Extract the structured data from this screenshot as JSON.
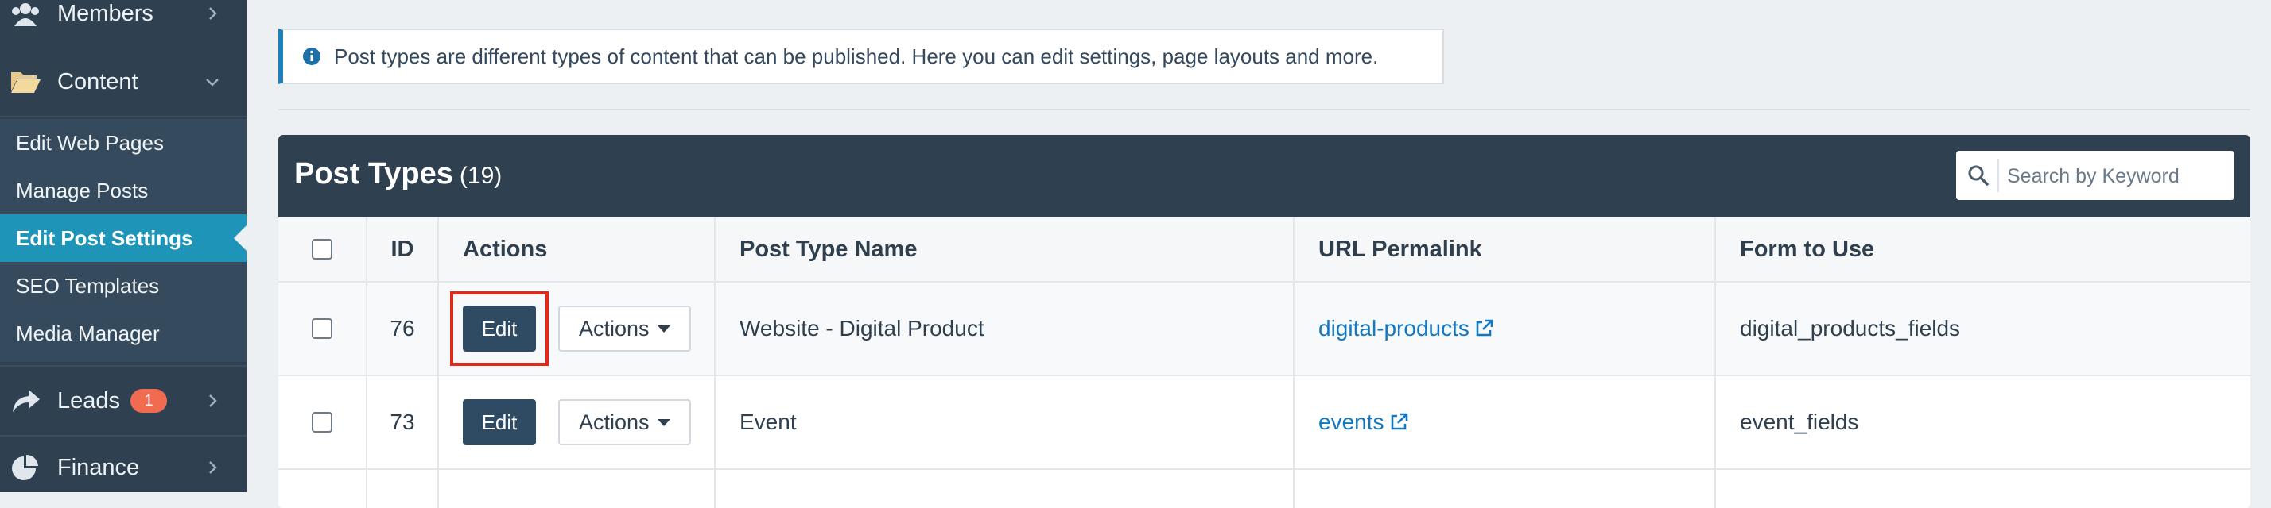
{
  "sidebar": {
    "members_label": "Members",
    "content_label": "Content",
    "submenu": [
      {
        "label": "Edit Web Pages"
      },
      {
        "label": "Manage Posts"
      },
      {
        "label": "Edit Post Settings"
      },
      {
        "label": "SEO Templates"
      },
      {
        "label": "Media Manager"
      }
    ],
    "leads_label": "Leads",
    "leads_badge": "1",
    "finance_label": "Finance"
  },
  "info": {
    "text": "Post types are different types of content that can be published. Here you can edit settings, page layouts and more."
  },
  "panel": {
    "title": "Post Types",
    "count": "(19)",
    "search_placeholder": "Search by Keyword"
  },
  "table": {
    "headers": {
      "id": "ID",
      "actions": "Actions",
      "name": "Post Type Name",
      "permalink": "URL Permalink",
      "form": "Form to Use"
    },
    "edit_label": "Edit",
    "actions_label": "Actions",
    "rows": [
      {
        "id": "76",
        "name": "Website - Digital Product",
        "permalink": "digital-products",
        "form": "digital_products_fields"
      },
      {
        "id": "73",
        "name": "Event",
        "permalink": "events",
        "form": "event_fields"
      }
    ]
  },
  "colors": {
    "sidebar_bg": "#2f4050",
    "active_item": "#1d94b8",
    "edit_button": "#2e4b63",
    "highlight": "#e02a19",
    "badge": "#f06b4f",
    "link": "#1378c2"
  }
}
